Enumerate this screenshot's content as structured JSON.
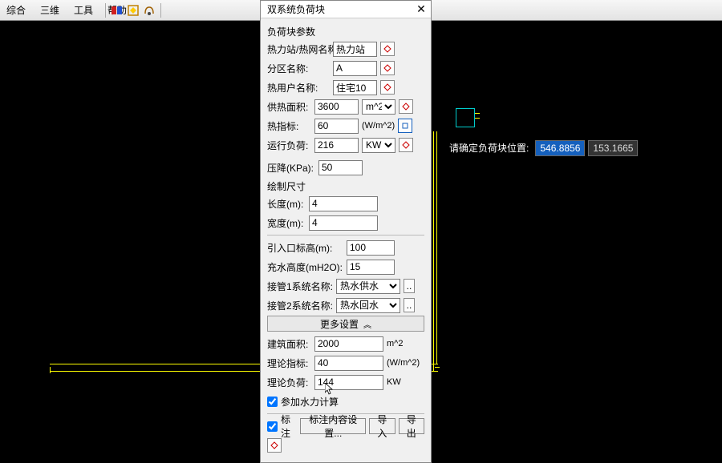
{
  "menubar": {
    "items": [
      "综合",
      "三维",
      "工具",
      "帮助"
    ]
  },
  "dialog": {
    "title": "双系统负荷块",
    "section_params": "负荷块参数",
    "fields": {
      "station_label": "热力站/热网名称:",
      "station_value": "热力站",
      "zone_label": "分区名称:",
      "zone_value": "A",
      "user_label": "热用户名称:",
      "user_value": "住宅10",
      "area_label": "供热面积:",
      "area_value": "3600",
      "area_unit": "m^2",
      "index_label": "热指标:",
      "index_value": "60",
      "index_unit": "(W/m^2)",
      "load_label": "运行负荷:",
      "load_value": "216",
      "load_unit": "KW",
      "pressure_label": "压降(KPa):",
      "pressure_value": "50"
    },
    "section_size": "绘制尺寸",
    "size": {
      "length_label": "长度(m):",
      "length_value": "4",
      "width_label": "宽度(m):",
      "width_value": "4"
    },
    "elev": {
      "inlet_label": "引入口标高(m):",
      "inlet_value": "100",
      "fill_label": "充水高度(mH2O):",
      "fill_value": "15"
    },
    "pipes": {
      "p1_label": "接管1系统名称:",
      "p1_value": "热水供水",
      "p2_label": "接管2系统名称:",
      "p2_value": "热水回水"
    },
    "more_label": "更多设置",
    "extended": {
      "barea_label": "建筑面积:",
      "barea_value": "2000",
      "barea_unit": "m^2",
      "tindex_label": "理论指标:",
      "tindex_value": "40",
      "tindex_unit": "(W/m^2)",
      "tload_label": "理论负荷:",
      "tload_value": "144",
      "tload_unit": "KW",
      "hydraulic_label": "参加水力计算"
    },
    "footer": {
      "annotate_label": "标注",
      "content_btn": "标注内容设置...",
      "import_btn": "导入",
      "export_btn": "导出"
    }
  },
  "prompt": {
    "label": "请确定负荷块位置:",
    "val1": "546.8856",
    "val2": "153.1665"
  }
}
